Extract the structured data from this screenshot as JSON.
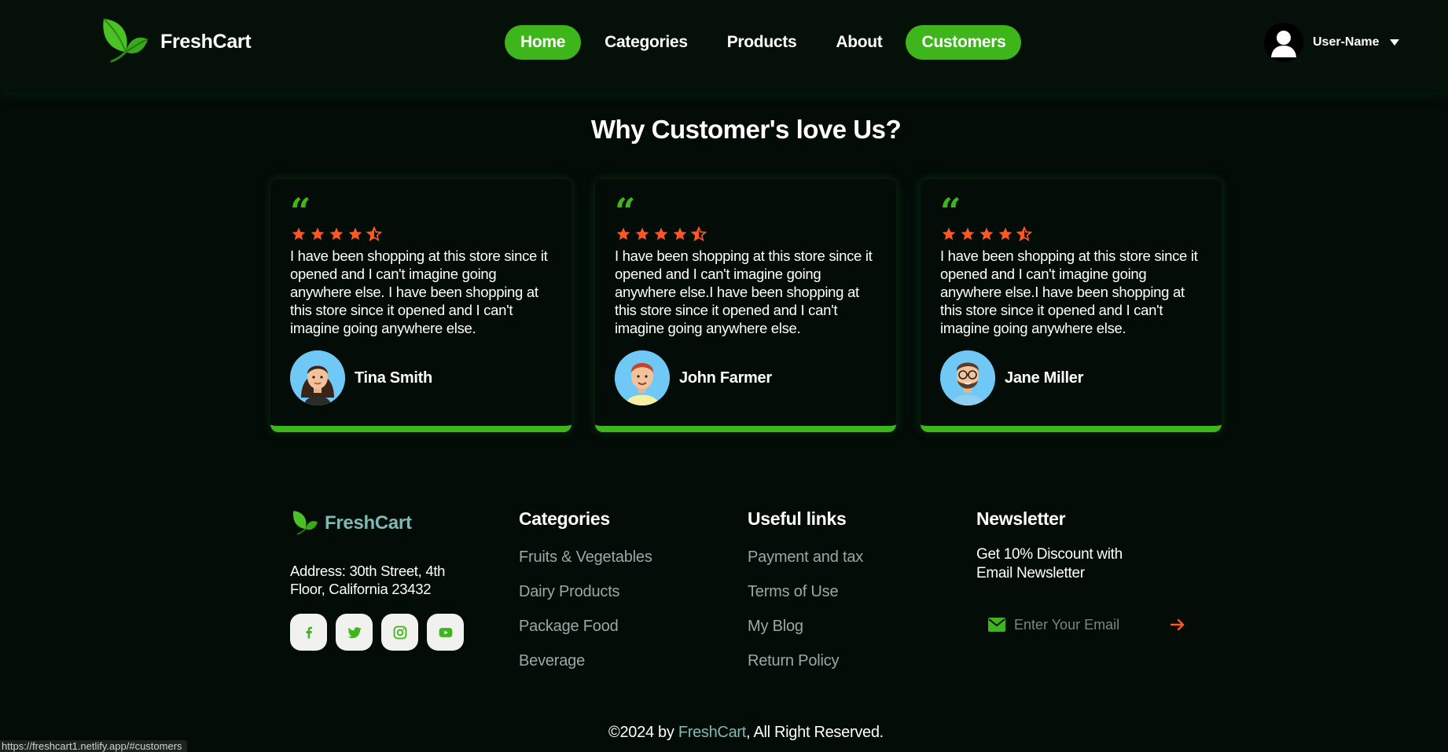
{
  "brand": {
    "name": "FreshCart"
  },
  "nav": {
    "items": [
      {
        "label": "Home",
        "active": true
      },
      {
        "label": "Categories",
        "active": false
      },
      {
        "label": "Products",
        "active": false
      },
      {
        "label": "About",
        "active": false
      },
      {
        "label": "Customers",
        "active": true
      }
    ]
  },
  "user": {
    "name": "User-Name",
    "icon": "user-avatar-icon",
    "menu_icon": "caret-down-icon"
  },
  "section": {
    "title": "Why Customer's love Us?"
  },
  "testimonials": [
    {
      "quote_icon": "quote-icon",
      "rating": 4.5,
      "text": "I have been shopping at this store since it opened and I can't imagine going anywhere else. I have been shopping at this store since it opened and I can't imagine going anywhere else.",
      "name": "Tina Smith"
    },
    {
      "quote_icon": "quote-icon",
      "rating": 4.5,
      "text": "I have been shopping at this store since it opened and I can't imagine going anywhere else.I have been shopping at this store since it opened and I can't imagine going anywhere else.",
      "name": "John Farmer"
    },
    {
      "quote_icon": "quote-icon",
      "rating": 4.5,
      "text": "I have been shopping at this store since it opened and I can't imagine going anywhere else.I have been shopping at this store since it opened and I can't imagine going anywhere else.",
      "name": "Jane Miller"
    }
  ],
  "footer": {
    "brand": "FreshCart",
    "address": "Address: 30th Street, 4th Floor, California 23432",
    "socials": [
      "facebook-icon",
      "twitter-icon",
      "instagram-icon",
      "youtube-icon"
    ],
    "categories": {
      "title": "Categories",
      "links": [
        "Fruits & Vegetables",
        "Dairy Products",
        "Package Food",
        "Beverage"
      ]
    },
    "useful_links": {
      "title": "Useful links",
      "links": [
        "Payment and tax",
        "Terms of Use",
        "My Blog",
        "Return Policy"
      ]
    },
    "newsletter": {
      "title": "Newsletter",
      "text": "Get 10% Discount with Email Newsletter",
      "placeholder": "Enter Your Email"
    },
    "copyright": {
      "prefix": "©2024 by ",
      "brand": "FreshCart",
      "suffix": ", All Right Reserved."
    }
  },
  "status_bar": {
    "url": "https://freshcart1.netlify.app/#customers"
  },
  "colors": {
    "accent": "#3db51b",
    "star": "#ff5722",
    "background": "#030c07",
    "muted_link": "#9aa9a7",
    "brand_footer": "#7fb8b4"
  }
}
